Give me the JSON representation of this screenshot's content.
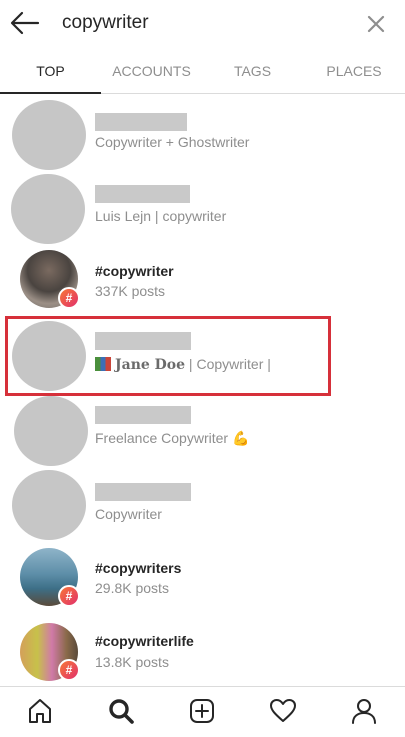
{
  "search": {
    "query": "copywriter"
  },
  "tabs": [
    {
      "label": "TOP"
    },
    {
      "label": "ACCOUNTS"
    },
    {
      "label": "TAGS"
    },
    {
      "label": "PLACES"
    }
  ],
  "results": [
    {
      "subtitle": "Copywriter + Ghostwriter"
    },
    {
      "subtitle": "Luis Lejn | copywriter"
    },
    {
      "title": "#copywriter",
      "subtitle": "337K posts",
      "badge": "#"
    },
    {
      "subtitle_name": "Jane Doe",
      "subtitle_rest": " | Copywriter |"
    },
    {
      "subtitle": "Freelance Copywriter",
      "emoji": "💪"
    },
    {
      "subtitle": "Copywriter"
    },
    {
      "title": "#copywriters",
      "subtitle": "29.8K posts",
      "badge": "#"
    },
    {
      "title": "#copywriterlife",
      "subtitle": "13.8K posts",
      "badge": "#"
    }
  ],
  "colors": {
    "highlight": "#d6303a",
    "badge_gradient_start": "#f77737",
    "badge_gradient_end": "#e1306c"
  },
  "nav": [
    "home-icon",
    "search-icon",
    "add-post-icon",
    "heart-icon",
    "profile-icon"
  ]
}
